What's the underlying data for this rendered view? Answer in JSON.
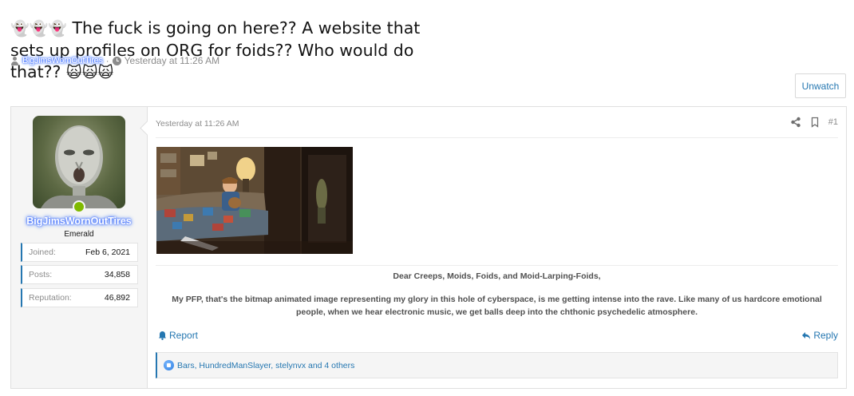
{
  "thread": {
    "title_ghosts": "👻👻👻",
    "title_text": " The fuck is going on here?? A website that sets up profiles on ORG for foids?? Who would do that?? ",
    "title_cats": "🙀🙀🙀",
    "author": "BigJimsWornOutTires",
    "separator": "·",
    "timestamp": "Yesterday at 11:26 AM",
    "watch_button": "Unwatch"
  },
  "post": {
    "user": {
      "name": "BigJimsWornOutTires",
      "title": "Emerald",
      "online": true,
      "stats": [
        {
          "label": "Joined:",
          "value": "Feb 6, 2021"
        },
        {
          "label": "Posts:",
          "value": "34,858"
        },
        {
          "label": "Reputation:",
          "value": "46,892"
        }
      ]
    },
    "date": "Yesterday at 11:26 AM",
    "number": "#1",
    "body": {
      "greeting": "Dear Creeps, Moids, Foids, and Moid-Larping-Foids,",
      "paragraph": "My PFP, that's the bitmap animated image representing my glory in this hole of cyberspace, is me getting intense into the rave. Like many of us hardcore emotional people, when we hear electronic music, we get balls deep into the chthonic psychedelic atmosphere."
    },
    "report_label": "Report",
    "reply_label": "Reply",
    "reactions_text": "Bars, HundredManSlayer, stelynvx and 4 others"
  },
  "colors": {
    "link": "#2577b1",
    "online": "#7fb900",
    "muted": "#8c8c8c"
  }
}
